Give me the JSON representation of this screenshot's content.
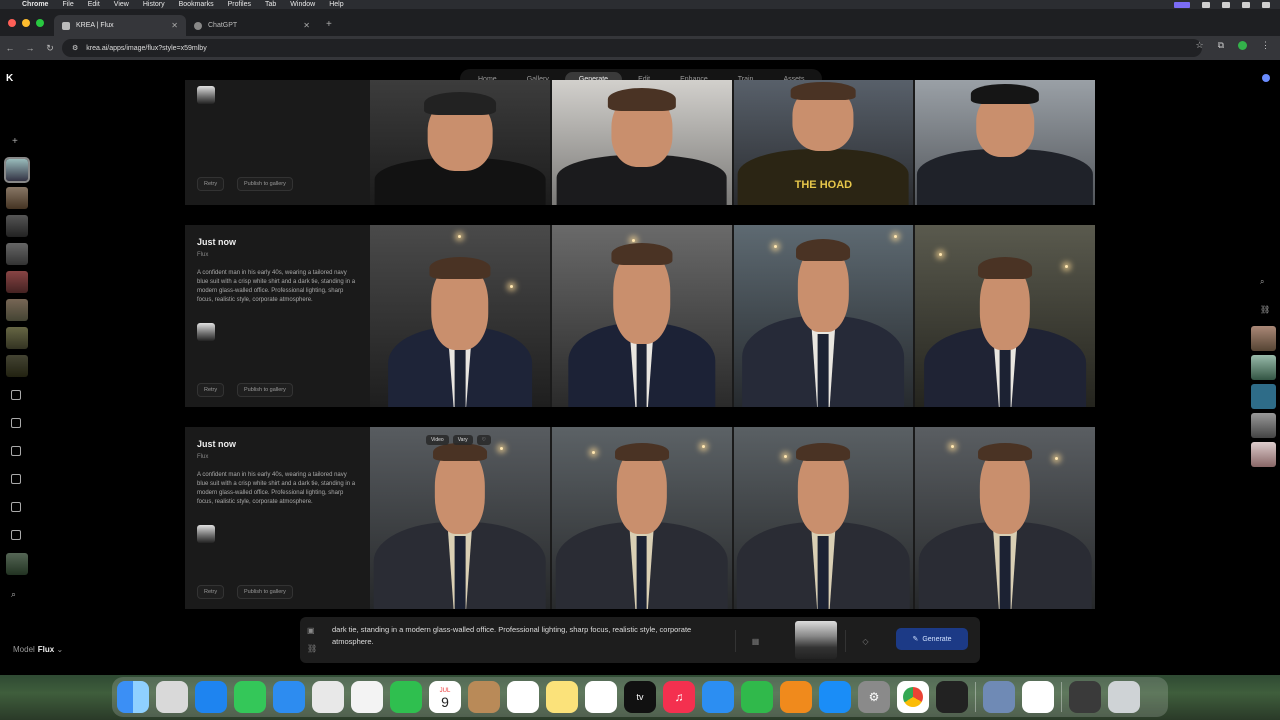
{
  "menubar": {
    "app": "Chrome",
    "items": [
      "File",
      "Edit",
      "View",
      "History",
      "Bookmarks",
      "Profiles",
      "Tab",
      "Window",
      "Help"
    ]
  },
  "browser": {
    "tabs": [
      {
        "title": "KREA | Flux",
        "active": true
      },
      {
        "title": "ChatGPT",
        "active": false
      }
    ],
    "url": "krea.ai/apps/image/flux?style=x59mlby"
  },
  "app": {
    "logo": "K",
    "nav": [
      "Home",
      "Gallery",
      "Generate",
      "Edit",
      "Enhance",
      "Train",
      "Assets"
    ],
    "active_nav": "Generate",
    "model_label": "Model",
    "model_value": "Flux",
    "model_chevron": "⌄"
  },
  "generations": [
    {
      "title": "",
      "model": "",
      "prompt": "",
      "retry_label": "Retry",
      "publish_label": "Publish to gallery",
      "shirt_text": "THE HOAD"
    },
    {
      "title": "Just now",
      "model": "Flux",
      "prompt": "A confident man in his early 40s, wearing a tailored navy blue suit with a crisp white shirt and a dark tie, standing in a modern glass-walled office. Professional lighting, sharp focus, realistic style, corporate atmosphere.",
      "retry_label": "Retry",
      "publish_label": "Publish to gallery"
    },
    {
      "title": "Just now",
      "model": "Flux",
      "prompt": "A confident man in his early 40s, wearing a tailored navy blue suit with a crisp white shirt and a dark tie, standing in a modern glass-walled office. Professional lighting, sharp focus, realistic style, corporate atmosphere.",
      "retry_label": "Retry",
      "publish_label": "Publish to gallery",
      "hover_actions": [
        "Video",
        "Vary"
      ]
    }
  ],
  "prompt_bar": {
    "text": "dark tie, standing in a modern glass-walled office. Professional lighting, sharp focus, realistic style, corporate atmosphere.",
    "generate_label": "Generate"
  },
  "dock": {
    "calendar_month": "JUL",
    "calendar_day": "9",
    "tv_label": "tv"
  },
  "colors": {
    "accent": "#1c3a86",
    "background": "#000000",
    "card": "#1a1a1a"
  }
}
